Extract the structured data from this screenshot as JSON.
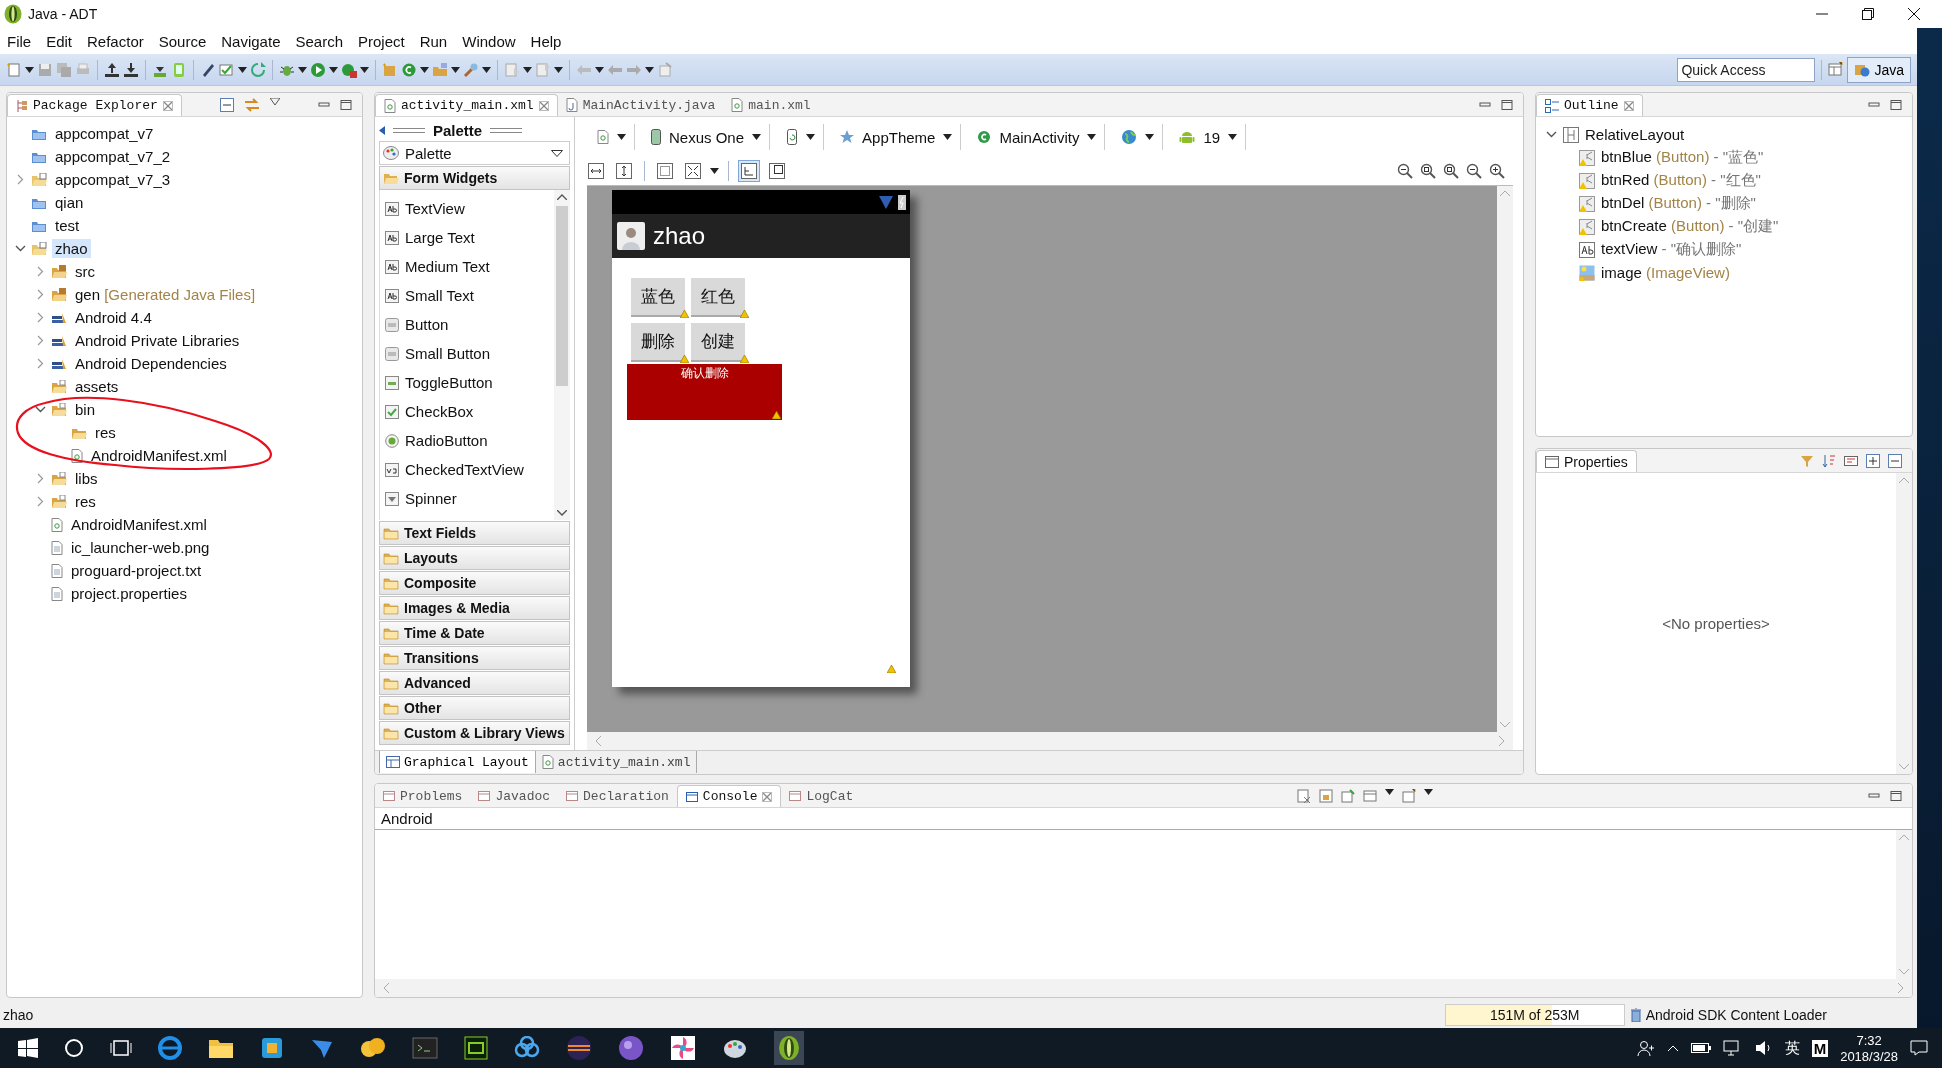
{
  "window": {
    "title": "Java - ADT"
  },
  "menu": [
    "File",
    "Edit",
    "Refactor",
    "Source",
    "Navigate",
    "Search",
    "Project",
    "Run",
    "Window",
    "Help"
  ],
  "quick_access": {
    "placeholder": "Quick Access"
  },
  "perspective": {
    "label": "Java",
    "selected": true
  },
  "package_explorer": {
    "title": "Package Explorer",
    "tree": [
      {
        "label": "appcompat_v7",
        "kind": "closed-project",
        "selected": false
      },
      {
        "label": "appcompat_v7_2",
        "kind": "closed-project",
        "selected": false
      },
      {
        "label": "appcompat_v7_3",
        "kind": "project",
        "expanded": false,
        "selected": false
      },
      {
        "label": "qian",
        "kind": "closed-project",
        "selected": false
      },
      {
        "label": "test",
        "kind": "closed-project",
        "selected": false
      },
      {
        "label": "zhao",
        "kind": "project",
        "expanded": true,
        "selected": true,
        "children": [
          {
            "label": "src",
            "kind": "source-folder",
            "expanded": false,
            "selected": false
          },
          {
            "label": "gen",
            "note": "[Generated Java Files]",
            "kind": "source-folder",
            "expanded": false,
            "selected": false
          },
          {
            "label": "Android 4.4",
            "kind": "library",
            "expanded": false,
            "selected": false
          },
          {
            "label": "Android Private Libraries",
            "kind": "library",
            "expanded": false,
            "selected": false
          },
          {
            "label": "Android Dependencies",
            "kind": "library",
            "expanded": false,
            "selected": false
          },
          {
            "label": "assets",
            "kind": "folder",
            "selected": false
          },
          {
            "label": "bin",
            "kind": "folder",
            "expanded": true,
            "selected": false,
            "children": [
              {
                "label": "res",
                "kind": "open-folder",
                "selected": false
              },
              {
                "label": "AndroidManifest.xml",
                "kind": "xml-file",
                "selected": false
              }
            ]
          },
          {
            "label": "libs",
            "kind": "folder",
            "expanded": false,
            "selected": false
          },
          {
            "label": "res",
            "kind": "folder",
            "expanded": false,
            "selected": false
          },
          {
            "label": "AndroidManifest.xml",
            "kind": "xml-file",
            "selected": false
          },
          {
            "label": "ic_launcher-web.png",
            "kind": "file",
            "selected": false
          },
          {
            "label": "proguard-project.txt",
            "kind": "file",
            "selected": false
          },
          {
            "label": "project.properties",
            "kind": "file",
            "selected": false
          }
        ]
      }
    ]
  },
  "editor": {
    "tabs": [
      {
        "label": "activity_main.xml",
        "kind": "xml",
        "selected": true
      },
      {
        "label": "MainActivity.java",
        "kind": "java",
        "selected": false
      },
      {
        "label": "main.xml",
        "kind": "xml",
        "selected": false
      }
    ],
    "palette": {
      "title": "Palette",
      "dropdown": "Palette",
      "categories": [
        {
          "label": "Form Widgets",
          "expanded": true,
          "items": [
            {
              "label": "TextView",
              "kind": "text"
            },
            {
              "label": "Large Text",
              "kind": "text"
            },
            {
              "label": "Medium Text",
              "kind": "text"
            },
            {
              "label": "Small Text",
              "kind": "text"
            },
            {
              "label": "Button",
              "kind": "button"
            },
            {
              "label": "Small Button",
              "kind": "button"
            },
            {
              "label": "ToggleButton",
              "kind": "toggle"
            },
            {
              "label": "CheckBox",
              "kind": "checkbox"
            },
            {
              "label": "RadioButton",
              "kind": "radio"
            },
            {
              "label": "CheckedTextView",
              "kind": "checked-text"
            },
            {
              "label": "Spinner",
              "kind": "spinner"
            }
          ]
        },
        {
          "label": "Text Fields",
          "expanded": false
        },
        {
          "label": "Layouts",
          "expanded": false
        },
        {
          "label": "Composite",
          "expanded": false
        },
        {
          "label": "Images & Media",
          "expanded": false
        },
        {
          "label": "Time & Date",
          "expanded": false
        },
        {
          "label": "Transitions",
          "expanded": false
        },
        {
          "label": "Advanced",
          "expanded": false
        },
        {
          "label": "Other",
          "expanded": false
        },
        {
          "label": "Custom & Library Views",
          "expanded": false
        }
      ]
    },
    "config": [
      {
        "kind": "file"
      },
      {
        "kind": "device",
        "label": "Nexus One"
      },
      {
        "kind": "orientation"
      },
      {
        "kind": "theme",
        "label": "AppTheme"
      },
      {
        "kind": "activity",
        "label": "MainActivity"
      },
      {
        "kind": "locale"
      },
      {
        "kind": "api",
        "label": "19"
      }
    ],
    "layout_tools": [
      {
        "kind": "fill-width",
        "selected": false
      },
      {
        "kind": "fill-height",
        "selected": false
      },
      {
        "kind": "margins",
        "selected": false
      },
      {
        "kind": "resize",
        "selected": false
      },
      {
        "kind": "show-included",
        "selected": true
      },
      {
        "kind": "clip",
        "selected": false
      }
    ],
    "phone": {
      "app_title": "zhao",
      "buttons": [
        "蓝色",
        "红色",
        "删除",
        "创建"
      ],
      "text_view": "确认删除"
    },
    "bottom_tabs": [
      {
        "label": "Graphical Layout",
        "selected": true
      },
      {
        "label": "activity_main.xml",
        "selected": false
      }
    ]
  },
  "outline": {
    "title": "Outline",
    "root": {
      "label": "RelativeLayout",
      "expanded": true,
      "children": [
        {
          "name": "btnBlue",
          "type": "(Button)",
          "value": "- \"蓝色\"",
          "kind": "button"
        },
        {
          "name": "btnRed",
          "type": "(Button)",
          "value": "- \"红色\"",
          "kind": "button"
        },
        {
          "name": "btnDel",
          "type": "(Button)",
          "value": "- \"删除\"",
          "kind": "button"
        },
        {
          "name": "btnCreate",
          "type": "(Button)",
          "value": "- \"创建\"",
          "kind": "button"
        },
        {
          "name": "textView",
          "value": "- \"确认删除\"",
          "kind": "text"
        },
        {
          "name": "image",
          "type": "(ImageView)",
          "kind": "image"
        }
      ]
    }
  },
  "properties": {
    "title": "Properties",
    "empty": "<No properties>"
  },
  "console": {
    "tabs": [
      {
        "label": "Problems",
        "selected": false
      },
      {
        "label": "Javadoc",
        "selected": false
      },
      {
        "label": "Declaration",
        "selected": false
      },
      {
        "label": "Console",
        "selected": true
      },
      {
        "label": "LogCat",
        "selected": false
      }
    ],
    "header": "Android"
  },
  "status_bar": {
    "selection": "zhao",
    "heap": {
      "label": "151M of 253M",
      "level": 0.6
    },
    "job": "Android SDK Content Loader"
  },
  "taskbar": {
    "ime_language": "英",
    "ime_mode": "M",
    "time": "7:32",
    "date": "2018/3/28"
  }
}
